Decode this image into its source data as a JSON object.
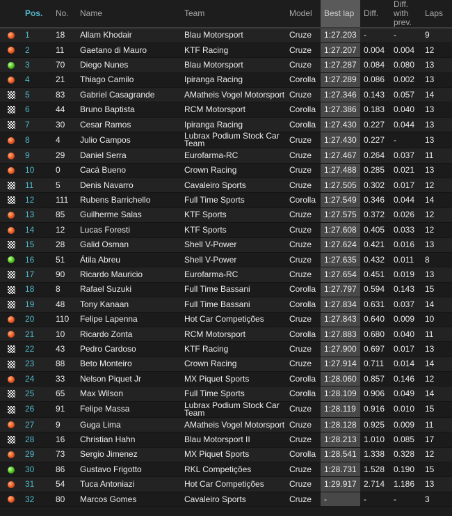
{
  "headers": {
    "pos": "Pos.",
    "no": "No.",
    "name": "Name",
    "team": "Team",
    "model": "Model",
    "best": "Best lap",
    "diff": "Diff.",
    "prev": "Diff. with prev.",
    "laps": "Laps"
  },
  "status_colors": {
    "orange": "#e8551f",
    "green": "#4bc01c"
  },
  "rows": [
    {
      "status": "orange-dot",
      "pos": "1",
      "no": "18",
      "name": "Allam Khodair",
      "team": "Blau Motorsport",
      "model": "Cruze",
      "best": "1:27.203",
      "diff": "-",
      "prev": "-",
      "laps": "9"
    },
    {
      "status": "orange-dot",
      "pos": "2",
      "no": "11",
      "name": "Gaetano di Mauro",
      "team": "KTF Racing",
      "model": "Cruze",
      "best": "1:27.207",
      "diff": "0.004",
      "prev": "0.004",
      "laps": "12"
    },
    {
      "status": "green-dot",
      "pos": "3",
      "no": "70",
      "name": "Diego Nunes",
      "team": "Blau Motorsport",
      "model": "Cruze",
      "best": "1:27.287",
      "diff": "0.084",
      "prev": "0.080",
      "laps": "13"
    },
    {
      "status": "orange-dot",
      "pos": "4",
      "no": "21",
      "name": "Thiago Camilo",
      "team": "Ipiranga Racing",
      "model": "Corolla",
      "best": "1:27.289",
      "diff": "0.086",
      "prev": "0.002",
      "laps": "13"
    },
    {
      "status": "checkered-flag",
      "pos": "5",
      "no": "83",
      "name": "Gabriel Casagrande",
      "team": "AMatheis Vogel Motorsport",
      "model": "Cruze",
      "best": "1:27.346",
      "diff": "0.143",
      "prev": "0.057",
      "laps": "14"
    },
    {
      "status": "checkered-flag",
      "pos": "6",
      "no": "44",
      "name": "Bruno Baptista",
      "team": "RCM Motorsport",
      "model": "Corolla",
      "best": "1:27.386",
      "diff": "0.183",
      "prev": "0.040",
      "laps": "13"
    },
    {
      "status": "checkered-flag",
      "pos": "7",
      "no": "30",
      "name": "Cesar Ramos",
      "team": "Ipiranga Racing",
      "model": "Corolla",
      "best": "1:27.430",
      "diff": "0.227",
      "prev": "0.044",
      "laps": "13"
    },
    {
      "status": "orange-dot",
      "pos": "8",
      "no": "4",
      "name": "Julio Campos",
      "team": "Lubrax Podium Stock Car Team",
      "model": "Cruze",
      "best": "1:27.430",
      "diff": "0.227",
      "prev": "-",
      "laps": "13"
    },
    {
      "status": "orange-dot",
      "pos": "9",
      "no": "29",
      "name": "Daniel Serra",
      "team": "Eurofarma-RC",
      "model": "Cruze",
      "best": "1:27.467",
      "diff": "0.264",
      "prev": "0.037",
      "laps": "11"
    },
    {
      "status": "orange-dot",
      "pos": "10",
      "no": "0",
      "name": "Cacá Bueno",
      "team": "Crown Racing",
      "model": "Cruze",
      "best": "1:27.488",
      "diff": "0.285",
      "prev": "0.021",
      "laps": "13"
    },
    {
      "status": "checkered-flag",
      "pos": "11",
      "no": "5",
      "name": "Denis Navarro",
      "team": "Cavaleiro Sports",
      "model": "Cruze",
      "best": "1:27.505",
      "diff": "0.302",
      "prev": "0.017",
      "laps": "12"
    },
    {
      "status": "checkered-flag",
      "pos": "12",
      "no": "111",
      "name": "Rubens Barrichello",
      "team": "Full Time Sports",
      "model": "Corolla",
      "best": "1:27.549",
      "diff": "0.346",
      "prev": "0.044",
      "laps": "14"
    },
    {
      "status": "orange-dot",
      "pos": "13",
      "no": "85",
      "name": "Guilherme Salas",
      "team": "KTF Sports",
      "model": "Cruze",
      "best": "1:27.575",
      "diff": "0.372",
      "prev": "0.026",
      "laps": "12"
    },
    {
      "status": "orange-dot",
      "pos": "14",
      "no": "12",
      "name": "Lucas Foresti",
      "team": "KTF Sports",
      "model": "Cruze",
      "best": "1:27.608",
      "diff": "0.405",
      "prev": "0.033",
      "laps": "12"
    },
    {
      "status": "checkered-flag",
      "pos": "15",
      "no": "28",
      "name": "Galid Osman",
      "team": "Shell V-Power",
      "model": "Cruze",
      "best": "1:27.624",
      "diff": "0.421",
      "prev": "0.016",
      "laps": "13"
    },
    {
      "status": "green-dot",
      "pos": "16",
      "no": "51",
      "name": "Átila Abreu",
      "team": "Shell V-Power",
      "model": "Cruze",
      "best": "1:27.635",
      "diff": "0.432",
      "prev": "0.011",
      "laps": "8"
    },
    {
      "status": "checkered-flag",
      "pos": "17",
      "no": "90",
      "name": "Ricardo Mauricio",
      "team": "Eurofarma-RC",
      "model": "Cruze",
      "best": "1:27.654",
      "diff": "0.451",
      "prev": "0.019",
      "laps": "13"
    },
    {
      "status": "checkered-flag",
      "pos": "18",
      "no": "8",
      "name": "Rafael Suzuki",
      "team": "Full Time Bassani",
      "model": "Corolla",
      "best": "1:27.797",
      "diff": "0.594",
      "prev": "0.143",
      "laps": "15"
    },
    {
      "status": "checkered-flag",
      "pos": "19",
      "no": "48",
      "name": "Tony Kanaan",
      "team": "Full Time Bassani",
      "model": "Corolla",
      "best": "1:27.834",
      "diff": "0.631",
      "prev": "0.037",
      "laps": "14"
    },
    {
      "status": "orange-dot",
      "pos": "20",
      "no": "110",
      "name": "Felipe Lapenna",
      "team": "Hot Car Competições",
      "model": "Cruze",
      "best": "1:27.843",
      "diff": "0.640",
      "prev": "0.009",
      "laps": "10"
    },
    {
      "status": "orange-dot",
      "pos": "21",
      "no": "10",
      "name": "Ricardo Zonta",
      "team": "RCM Motorsport",
      "model": "Corolla",
      "best": "1:27.883",
      "diff": "0.680",
      "prev": "0.040",
      "laps": "11"
    },
    {
      "status": "checkered-flag",
      "pos": "22",
      "no": "43",
      "name": "Pedro Cardoso",
      "team": "KTF Racing",
      "model": "Cruze",
      "best": "1:27.900",
      "diff": "0.697",
      "prev": "0.017",
      "laps": "13"
    },
    {
      "status": "checkered-flag",
      "pos": "23",
      "no": "88",
      "name": "Beto Monteiro",
      "team": "Crown Racing",
      "model": "Cruze",
      "best": "1:27.914",
      "diff": "0.711",
      "prev": "0.014",
      "laps": "14"
    },
    {
      "status": "orange-dot",
      "pos": "24",
      "no": "33",
      "name": "Nelson Piquet Jr",
      "team": "MX Piquet Sports",
      "model": "Corolla",
      "best": "1:28.060",
      "diff": "0.857",
      "prev": "0.146",
      "laps": "12"
    },
    {
      "status": "checkered-flag",
      "pos": "25",
      "no": "65",
      "name": "Max Wilson",
      "team": "Full Time Sports",
      "model": "Corolla",
      "best": "1:28.109",
      "diff": "0.906",
      "prev": "0.049",
      "laps": "14"
    },
    {
      "status": "checkered-flag",
      "pos": "26",
      "no": "91",
      "name": "Felipe Massa",
      "team": "Lubrax Podium Stock Car Team",
      "model": "Cruze",
      "best": "1:28.119",
      "diff": "0.916",
      "prev": "0.010",
      "laps": "15"
    },
    {
      "status": "orange-dot",
      "pos": "27",
      "no": "9",
      "name": "Guga Lima",
      "team": "AMatheis Vogel Motorsport",
      "model": "Cruze",
      "best": "1:28.128",
      "diff": "0.925",
      "prev": "0.009",
      "laps": "11"
    },
    {
      "status": "checkered-flag",
      "pos": "28",
      "no": "16",
      "name": "Christian Hahn",
      "team": "Blau Motorsport II",
      "model": "Cruze",
      "best": "1:28.213",
      "diff": "1.010",
      "prev": "0.085",
      "laps": "17"
    },
    {
      "status": "orange-dot",
      "pos": "29",
      "no": "73",
      "name": "Sergio Jimenez",
      "team": "MX Piquet Sports",
      "model": "Corolla",
      "best": "1:28.541",
      "diff": "1.338",
      "prev": "0.328",
      "laps": "12"
    },
    {
      "status": "green-dot",
      "pos": "30",
      "no": "86",
      "name": "Gustavo Frigotto",
      "team": "RKL Competições",
      "model": "Cruze",
      "best": "1:28.731",
      "diff": "1.528",
      "prev": "0.190",
      "laps": "15"
    },
    {
      "status": "orange-dot",
      "pos": "31",
      "no": "54",
      "name": "Tuca Antoniazi",
      "team": "Hot Car Competições",
      "model": "Cruze",
      "best": "1:29.917",
      "diff": "2.714",
      "prev": "1.186",
      "laps": "13"
    },
    {
      "status": "orange-dot",
      "pos": "32",
      "no": "80",
      "name": "Marcos Gomes",
      "team": "Cavaleiro Sports",
      "model": "Cruze",
      "best": "-",
      "diff": "-",
      "prev": "-",
      "laps": "3"
    }
  ]
}
